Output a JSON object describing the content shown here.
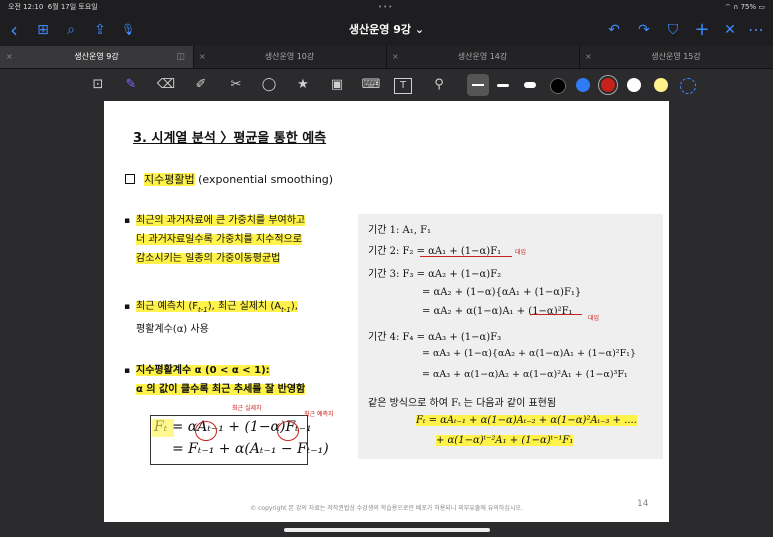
{
  "status": {
    "time": "오전 12:10",
    "date": "6월 17일 토요일",
    "battery": "75%"
  },
  "nav": {
    "title": "생산운영 9강 ⌄"
  },
  "tabs": [
    {
      "label": "생산운영 9강",
      "active": true
    },
    {
      "label": "생산운영 10강",
      "active": false
    },
    {
      "label": "생산운영 14강",
      "active": false
    },
    {
      "label": "생산운영 15강",
      "active": false
    }
  ],
  "icons": {
    "back": "‹",
    "grid": "⊞",
    "search": "⌕",
    "share": "⇪",
    "mic": "🎙",
    "undo": "↶",
    "redo": "↷",
    "bookmark": "⛉",
    "add": "+",
    "close": "✕",
    "more": "⋯",
    "tab_close": "×",
    "split": "◫"
  },
  "tools": [
    "⊡",
    "✎",
    "⌫",
    "✐",
    "✂",
    "◯",
    "★",
    "▣",
    "⌨",
    "T",
    "⚲"
  ],
  "colors": {
    "accent": "#3d8bff",
    "black": "#000000",
    "blue": "#2f7bf5",
    "red": "#c8201a",
    "white": "#ffffff",
    "yellow": "#fff28a",
    "highlight": "#fff24a"
  },
  "slide": {
    "heading": "3. 시계열 분석 〉평균을 통한 예측",
    "section_box": "□",
    "section_hl": "지수평활법",
    "section_rest": " (exponential smoothing)",
    "bullet": "▪",
    "p1_l1": "최근의 과거자료에 큰 가중치를 부여하고",
    "p1_l2": "더 과거자료일수록 가중치를 지수적으로",
    "p1_l3": "감소시키는 일종의 가중이동평균법",
    "p2_l1": "최근 예측치 (F",
    "p2_sub1": "t-1",
    "p2_mid": "), 최근 실제치 (A",
    "p2_sub2": "t-1",
    "p2_end": "),",
    "p2_l2": "평활계수(α) 사용",
    "p3_l1": "지수평활계수 α (0 < α < 1):",
    "p3_l2": "α 의 값이 클수록 최근 추세를 잘 반영함",
    "f1": "Fₜ = αAₜ₋₁ + (1−α)Fₜ₋₁",
    "f2": "= Fₜ₋₁ + α(Aₜ₋₁ − Fₜ₋₁)",
    "ann1": "최근 실제치",
    "ann2": "최근 예측치",
    "g1": "기간 1:  A₁, F₁",
    "g2": "기간 2:  F₂ = αA₁ + (1−α)F₁",
    "g3": "기간 3:  F₃ = αA₂ + (1−α)F₂",
    "g3b": "= αA₂ + (1−α){αA₁ + (1−α)F₁}",
    "g3c": "= αA₂ + α(1−α)A₁ + (1−α)²F₁",
    "g4": "기간 4:  F₄ = αA₃ + (1−α)F₃",
    "g4b": "= αA₃ + (1−α){αA₂ + α(1−α)A₁ + (1−α)²F₁}",
    "g4c": "= αA₃ + α(1−α)A₂ + α(1−α)²A₁ + (1−α)³F₁",
    "g5": "같은 방식으로 하여  Fₜ 는 다음과 같이 표현됨",
    "g6": "Fₜ = αAₜ₋₁ + α(1−α)Aₜ₋₂ + α(1−α)²Aₜ₋₃ + ....",
    "g7": "+ α(1−α)ᵗ⁻²A₁ + (1−α)ᵗ⁻¹F₁",
    "ann3": "대입",
    "ann4": "대입",
    "footer": "© copyright 본 강의 자료는 저작권법상 수강생의 학습용으로만 배포가 허용되니 외부유출에 유의하십시오.",
    "page_num": "14"
  }
}
